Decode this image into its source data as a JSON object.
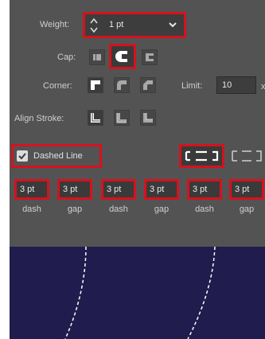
{
  "weight": {
    "label": "Weight:",
    "value": "1 pt"
  },
  "cap": {
    "label": "Cap:"
  },
  "corner": {
    "label": "Corner:",
    "limit_label": "Limit:",
    "limit_value": "10",
    "limit_suffix": "x"
  },
  "align_stroke": {
    "label": "Align Stroke:"
  },
  "dashed_line": {
    "label": "Dashed Line",
    "checked": true
  },
  "dash_gap": [
    {
      "value": "3 pt",
      "label": "dash"
    },
    {
      "value": "3 pt",
      "label": "gap"
    },
    {
      "value": "3 pt",
      "label": "dash"
    },
    {
      "value": "3 pt",
      "label": "gap"
    },
    {
      "value": "3 pt",
      "label": "dash"
    },
    {
      "value": "3 pt",
      "label": "gap"
    }
  ],
  "colors": {
    "panel": "#535353",
    "canvas": "#211c4e",
    "highlight": "#d5121e",
    "icon_active": "#ffffff",
    "icon_inactive": "#a8a8a8"
  }
}
